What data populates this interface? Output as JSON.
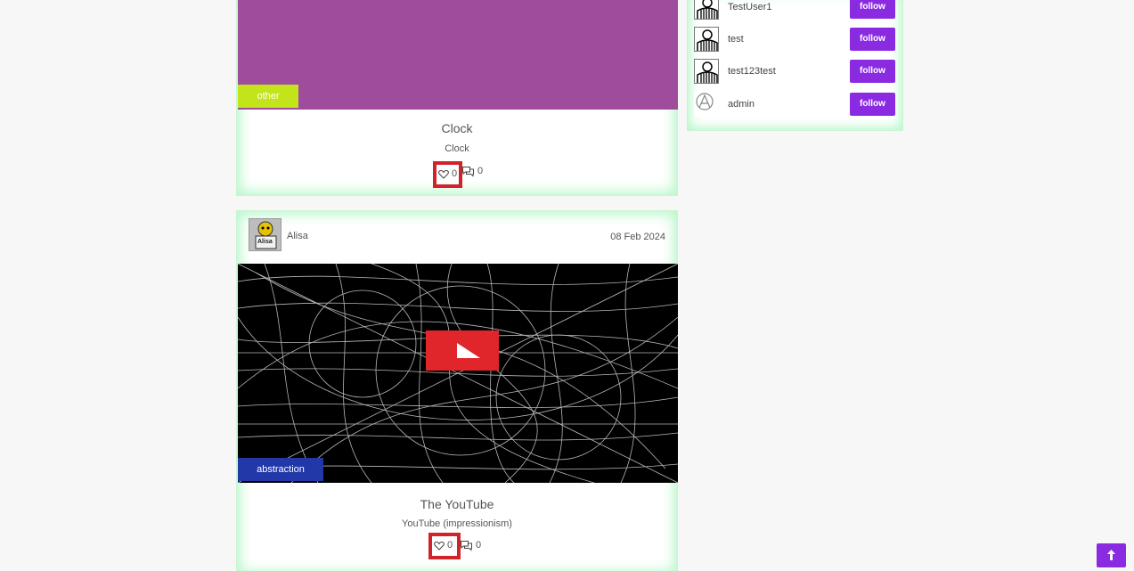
{
  "posts": [
    {
      "tag": "other",
      "title": "Clock",
      "subtitle": "Clock",
      "likes": "0",
      "comments": "0",
      "colors": {
        "media": "#a04c9d",
        "tag": "#c3e41a"
      }
    },
    {
      "author": "Alisa",
      "author_avatar_text": "Alisa",
      "date": "08 Feb 2024",
      "tag": "abstraction",
      "title": "The YouTube",
      "subtitle": "YouTube (impressionism)",
      "likes": "0",
      "comments": "0",
      "colors": {
        "media": "#000000",
        "tag": "#2237a8"
      }
    }
  ],
  "sidebar": {
    "users": [
      {
        "name": "TestUser1",
        "button": "follow"
      },
      {
        "name": "test",
        "button": "follow"
      },
      {
        "name": "test123test",
        "button": "follow"
      },
      {
        "name": "admin",
        "button": "follow"
      }
    ]
  },
  "icons": {
    "like": "heart-icon",
    "comment": "comment-icon",
    "back_to_top": "arrow-up-icon"
  },
  "colors": {
    "accent": "#8a2be2",
    "highlight": "#d0232a",
    "card_glow": "#b8f7c9"
  }
}
